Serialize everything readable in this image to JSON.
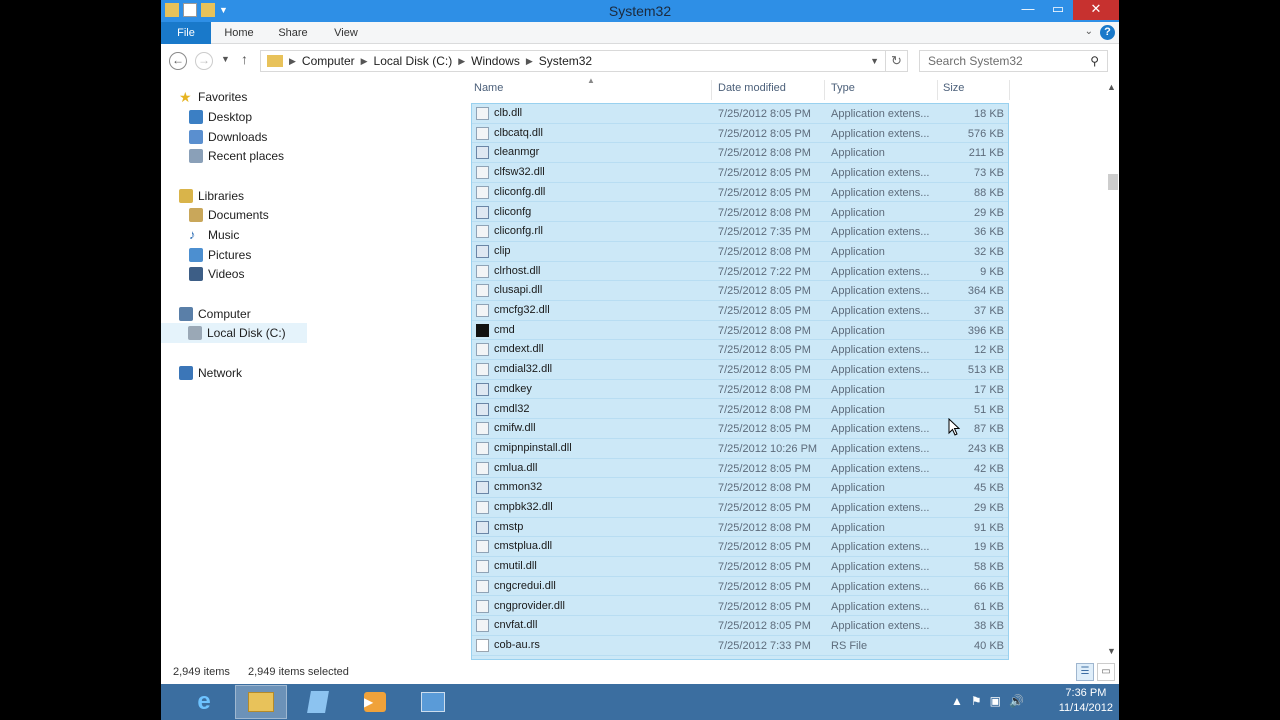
{
  "window": {
    "title": "System32",
    "controls": {
      "minimize": "—",
      "maximize": "▭",
      "close": "✕"
    }
  },
  "ribbon": {
    "tabs": [
      {
        "label": "File"
      },
      {
        "label": "Home"
      },
      {
        "label": "Share"
      },
      {
        "label": "View"
      }
    ],
    "help": "?"
  },
  "address": {
    "breadcrumbs": [
      "Computer",
      "Local Disk (C:)",
      "Windows",
      "System32"
    ],
    "search_placeholder": "Search System32"
  },
  "nav": {
    "favorites_label": "Favorites",
    "favorites": [
      "Desktop",
      "Downloads",
      "Recent places"
    ],
    "libraries_label": "Libraries",
    "libraries": [
      "Documents",
      "Music",
      "Pictures",
      "Videos"
    ],
    "computer_label": "Computer",
    "computer": [
      "Local Disk (C:)"
    ],
    "network_label": "Network"
  },
  "columns": {
    "name": "Name",
    "date": "Date modified",
    "type": "Type",
    "size": "Size"
  },
  "files": [
    {
      "name": "clb.dll",
      "date": "7/25/2012 8:05 PM",
      "type": "Application extens...",
      "size": "18 KB",
      "icon": "dll-icon"
    },
    {
      "name": "clbcatq.dll",
      "date": "7/25/2012 8:05 PM",
      "type": "Application extens...",
      "size": "576 KB",
      "icon": "dll-icon"
    },
    {
      "name": "cleanmgr",
      "date": "7/25/2012 8:08 PM",
      "type": "Application",
      "size": "211 KB",
      "icon": "app-icon"
    },
    {
      "name": "clfsw32.dll",
      "date": "7/25/2012 8:05 PM",
      "type": "Application extens...",
      "size": "73 KB",
      "icon": "dll-icon"
    },
    {
      "name": "cliconfg.dll",
      "date": "7/25/2012 8:05 PM",
      "type": "Application extens...",
      "size": "88 KB",
      "icon": "dll-icon"
    },
    {
      "name": "cliconfg",
      "date": "7/25/2012 8:08 PM",
      "type": "Application",
      "size": "29 KB",
      "icon": "app-icon"
    },
    {
      "name": "cliconfg.rll",
      "date": "7/25/2012 7:35 PM",
      "type": "Application extens...",
      "size": "36 KB",
      "icon": "dll-icon"
    },
    {
      "name": "clip",
      "date": "7/25/2012 8:08 PM",
      "type": "Application",
      "size": "32 KB",
      "icon": "app-icon"
    },
    {
      "name": "clrhost.dll",
      "date": "7/25/2012 7:22 PM",
      "type": "Application extens...",
      "size": "9 KB",
      "icon": "dll-icon"
    },
    {
      "name": "clusapi.dll",
      "date": "7/25/2012 8:05 PM",
      "type": "Application extens...",
      "size": "364 KB",
      "icon": "dll-icon"
    },
    {
      "name": "cmcfg32.dll",
      "date": "7/25/2012 8:05 PM",
      "type": "Application extens...",
      "size": "37 KB",
      "icon": "dll-icon"
    },
    {
      "name": "cmd",
      "date": "7/25/2012 8:08 PM",
      "type": "Application",
      "size": "396 KB",
      "icon": "console-icon"
    },
    {
      "name": "cmdext.dll",
      "date": "7/25/2012 8:05 PM",
      "type": "Application extens...",
      "size": "12 KB",
      "icon": "dll-icon"
    },
    {
      "name": "cmdial32.dll",
      "date": "7/25/2012 8:05 PM",
      "type": "Application extens...",
      "size": "513 KB",
      "icon": "dll-icon"
    },
    {
      "name": "cmdkey",
      "date": "7/25/2012 8:08 PM",
      "type": "Application",
      "size": "17 KB",
      "icon": "app-icon"
    },
    {
      "name": "cmdl32",
      "date": "7/25/2012 8:08 PM",
      "type": "Application",
      "size": "51 KB",
      "icon": "app-icon"
    },
    {
      "name": "cmifw.dll",
      "date": "7/25/2012 8:05 PM",
      "type": "Application extens...",
      "size": "87 KB",
      "icon": "dll-icon"
    },
    {
      "name": "cmipnpinstall.dll",
      "date": "7/25/2012 10:26 PM",
      "type": "Application extens...",
      "size": "243 KB",
      "icon": "dll-icon"
    },
    {
      "name": "cmlua.dll",
      "date": "7/25/2012 8:05 PM",
      "type": "Application extens...",
      "size": "42 KB",
      "icon": "dll-icon"
    },
    {
      "name": "cmmon32",
      "date": "7/25/2012 8:08 PM",
      "type": "Application",
      "size": "45 KB",
      "icon": "app-icon"
    },
    {
      "name": "cmpbk32.dll",
      "date": "7/25/2012 8:05 PM",
      "type": "Application extens...",
      "size": "29 KB",
      "icon": "dll-icon"
    },
    {
      "name": "cmstp",
      "date": "7/25/2012 8:08 PM",
      "type": "Application",
      "size": "91 KB",
      "icon": "app-icon"
    },
    {
      "name": "cmstplua.dll",
      "date": "7/25/2012 8:05 PM",
      "type": "Application extens...",
      "size": "19 KB",
      "icon": "dll-icon"
    },
    {
      "name": "cmutil.dll",
      "date": "7/25/2012 8:05 PM",
      "type": "Application extens...",
      "size": "58 KB",
      "icon": "dll-icon"
    },
    {
      "name": "cngcredui.dll",
      "date": "7/25/2012 8:05 PM",
      "type": "Application extens...",
      "size": "66 KB",
      "icon": "dll-icon"
    },
    {
      "name": "cngprovider.dll",
      "date": "7/25/2012 8:05 PM",
      "type": "Application extens...",
      "size": "61 KB",
      "icon": "dll-icon"
    },
    {
      "name": "cnvfat.dll",
      "date": "7/25/2012 8:05 PM",
      "type": "Application extens...",
      "size": "38 KB",
      "icon": "dll-icon"
    },
    {
      "name": "cob-au.rs",
      "date": "7/25/2012 7:33 PM",
      "type": "RS File",
      "size": "40 KB",
      "icon": "file-icon"
    }
  ],
  "status": {
    "items": "2,949 items",
    "selected": "2,949 items selected"
  },
  "taskbar": {
    "clock_time": "7:36 PM",
    "clock_date": "11/14/2012",
    "apps": [
      "ie-icon",
      "file-explorer-icon",
      "app-icon",
      "media-player-icon",
      "control-panel-icon"
    ]
  },
  "colors": {
    "accent": "#2e8fe6",
    "selection": "#cce8f7",
    "taskbar": "#3b6ea0",
    "close": "#c7312f"
  }
}
